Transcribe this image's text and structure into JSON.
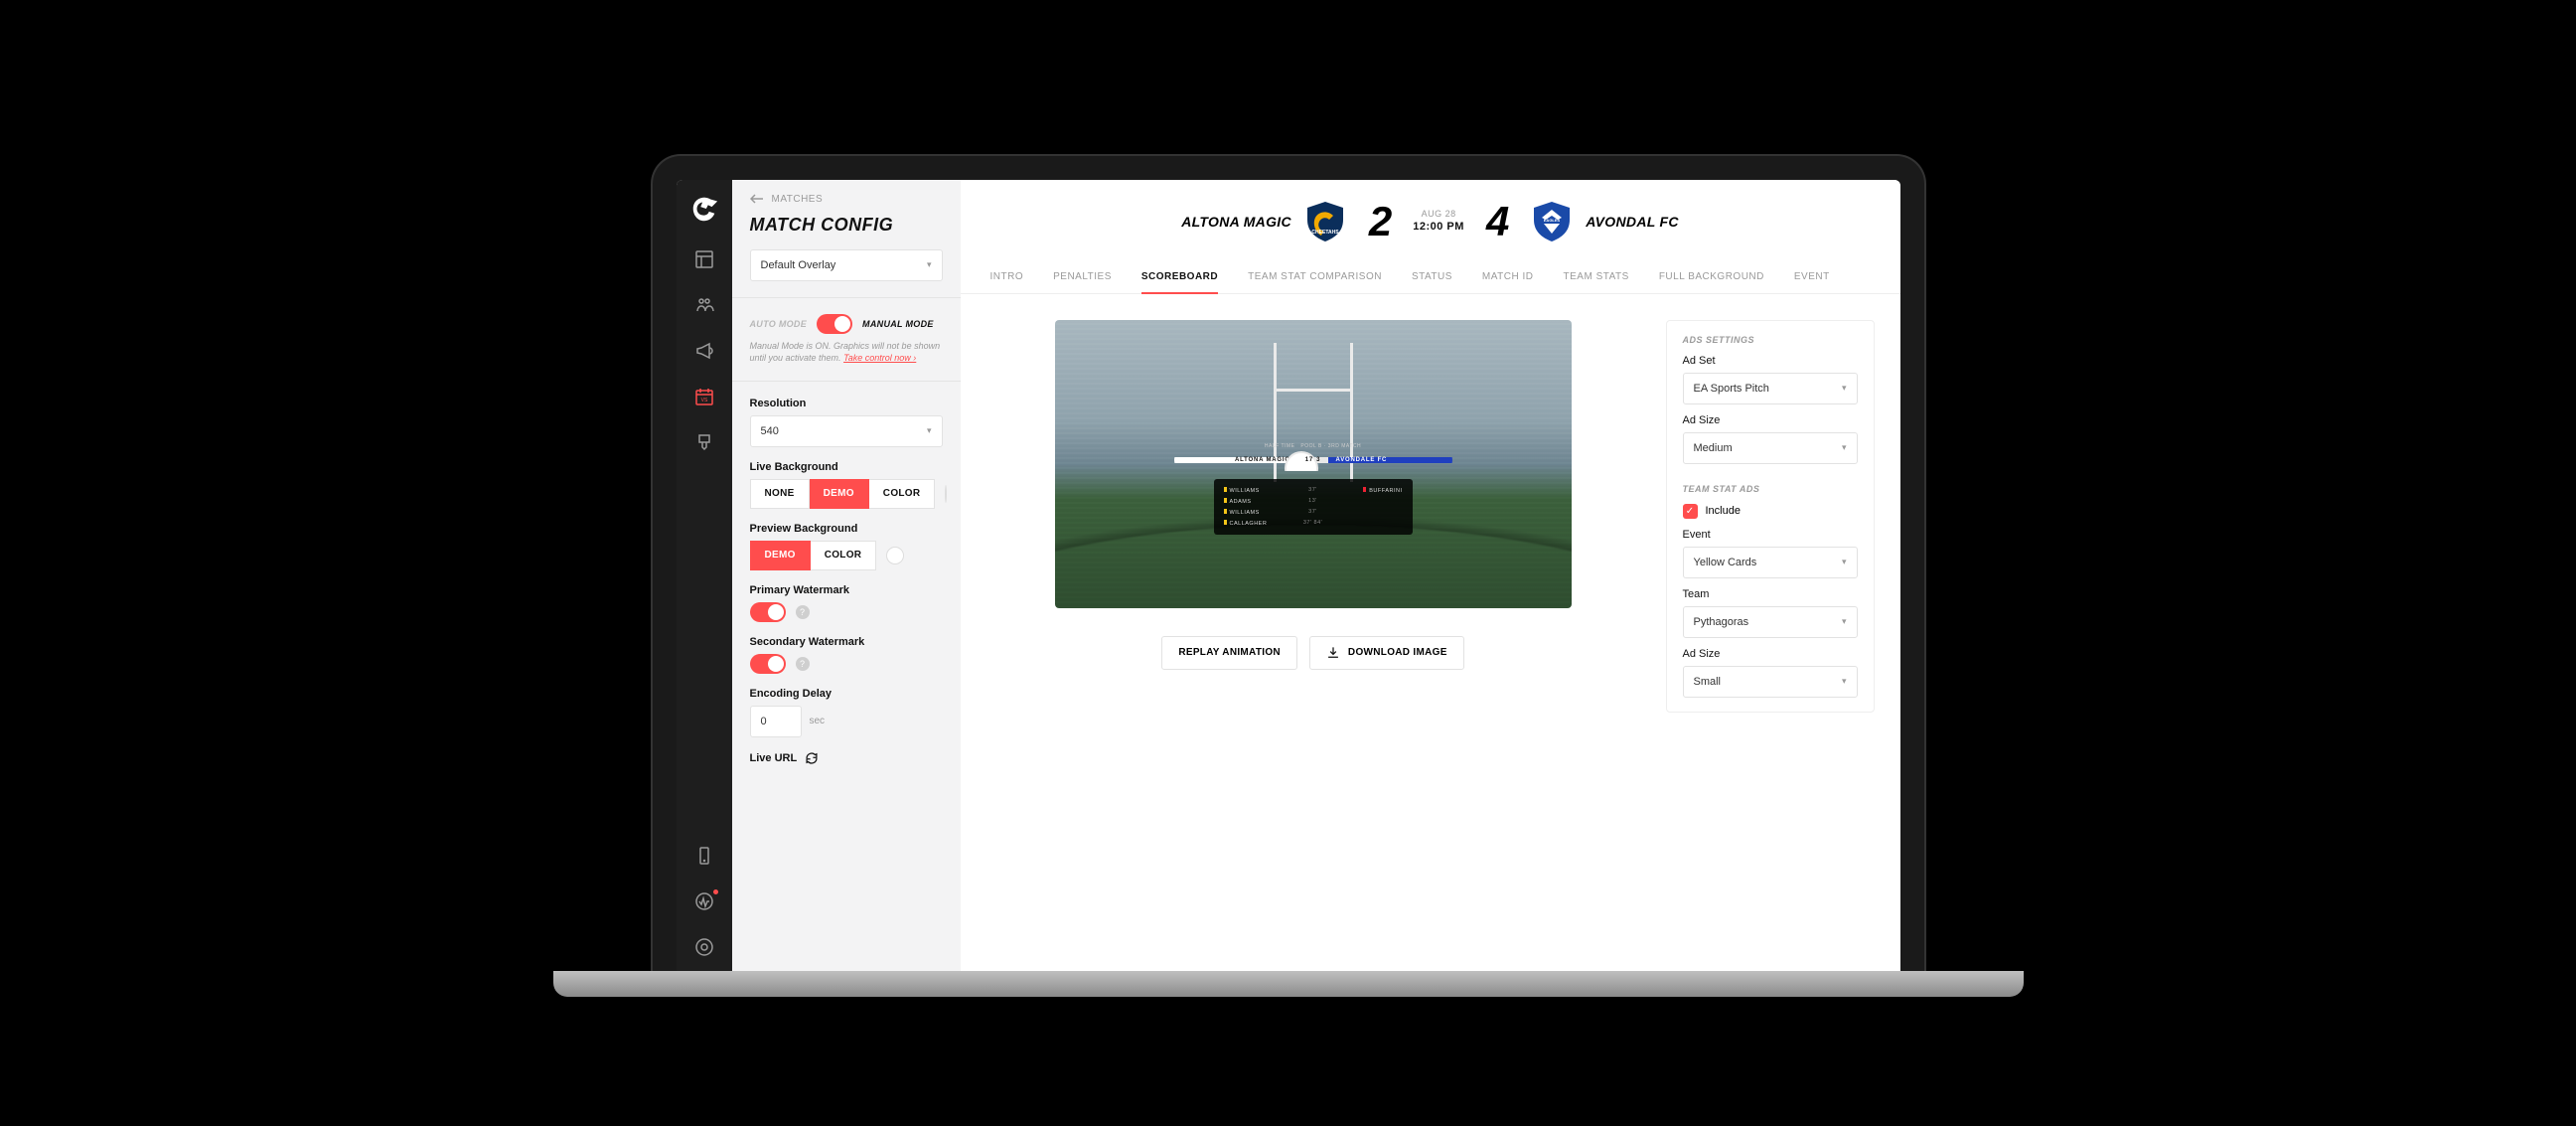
{
  "rail": {
    "items": [
      "layout",
      "people",
      "megaphone",
      "calendar",
      "brush"
    ],
    "active_index": 3,
    "bottom": [
      "device",
      "activity",
      "settings"
    ],
    "alert_index": 1
  },
  "config": {
    "back_label": "MATCHES",
    "title": "MATCH CONFIG",
    "overlay_select": "Default Overlay",
    "mode": {
      "auto_label": "AUTO MODE",
      "manual_label": "MANUAL MODE"
    },
    "helper_text": "Manual Mode is ON. Graphics will not be shown until you activate them. ",
    "helper_link": "Take control now ›",
    "resolution": {
      "label": "Resolution",
      "value": "540"
    },
    "live_bg": {
      "label": "Live Background",
      "options": [
        "NONE",
        "DEMO",
        "COLOR"
      ],
      "active": 1
    },
    "preview_bg": {
      "label": "Preview Background",
      "options": [
        "DEMO",
        "COLOR"
      ],
      "active": 0
    },
    "primary_wm": {
      "label": "Primary Watermark",
      "on": true
    },
    "secondary_wm": {
      "label": "Secondary Watermark",
      "on": true
    },
    "encoding": {
      "label": "Encoding Delay",
      "value": "0",
      "unit": "sec"
    },
    "live_url": {
      "label": "Live URL"
    }
  },
  "match": {
    "home": {
      "name": "ALTONA MAGIC",
      "score": "2"
    },
    "away": {
      "name": "AVONDAL FC",
      "score": "4"
    },
    "date": "AUG 28",
    "time": "12:00 PM"
  },
  "tabs": {
    "items": [
      "INTRO",
      "PENALTIES",
      "SCOREBOARD",
      "TEAM STAT COMPARISON",
      "STATUS",
      "MATCH ID",
      "TEAM STATS",
      "FULL BACKGROUND",
      "EVENT"
    ],
    "active": 2
  },
  "overlay": {
    "top_left": "HALF TIME",
    "top_right": "POOL B · 3RD MATCH",
    "home": "ALTONA MAGIC",
    "away": "AVONDALE FC",
    "score_home": "17",
    "score_away": "3",
    "rows": [
      {
        "l": "WILLIAMS",
        "c": "37'",
        "r": "BUFFARINI",
        "rtype": "rc"
      },
      {
        "l": "ADAMS",
        "c": "13'",
        "r": ""
      },
      {
        "l": "WILLIAMS",
        "c": "37'",
        "r": ""
      },
      {
        "l": "CALLAGHER",
        "c": "37' 84'",
        "r": ""
      }
    ]
  },
  "actions": {
    "replay": "REPLAY ANIMATION",
    "download": "DOWNLOAD IMAGE"
  },
  "ads": {
    "section1": "ADS SETTINGS",
    "ad_set": {
      "label": "Ad Set",
      "value": "EA Sports Pitch"
    },
    "ad_size1": {
      "label": "Ad Size",
      "value": "Medium"
    },
    "section2": "TEAM STAT ADS",
    "include": {
      "label": "Include",
      "checked": true
    },
    "event": {
      "label": "Event",
      "value": "Yellow Cards"
    },
    "team": {
      "label": "Team",
      "value": "Pythagoras"
    },
    "ad_size2": {
      "label": "Ad Size",
      "value": "Small"
    }
  }
}
